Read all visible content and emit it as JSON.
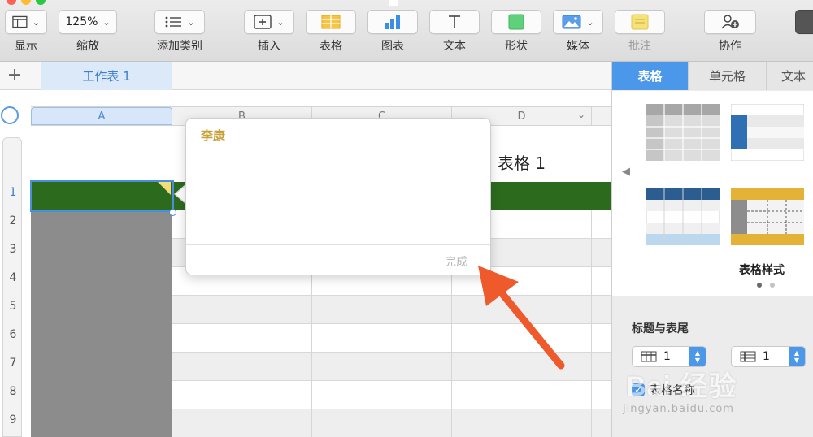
{
  "toolbar": {
    "view_label": "显示",
    "zoom_value": "125%",
    "zoom_label": "缩放",
    "add_category_label": "添加类别",
    "insert_label": "插入",
    "table_label": "表格",
    "chart_label": "图表",
    "text_label": "文本",
    "shape_label": "形状",
    "media_label": "媒体",
    "comment_label": "批注",
    "collaborate_label": "协作"
  },
  "sheets": {
    "active_tab": "工作表 1"
  },
  "table": {
    "title": "表格 1",
    "columns": [
      "A",
      "B",
      "C",
      "D"
    ],
    "rows": [
      "1",
      "2",
      "3",
      "4",
      "5",
      "6",
      "7",
      "8",
      "9"
    ],
    "header_color": "#2c6b1e",
    "selected_cell": "A1"
  },
  "comment": {
    "author": "李康",
    "done_label": "完成",
    "author_color": "#c7a13a"
  },
  "inspector": {
    "tabs": [
      "表格",
      "单元格",
      "文本"
    ],
    "active_tab": "表格",
    "styles_label": "表格样式",
    "header_footer_label": "标题与表尾",
    "header_rows": "1",
    "header_cols": "1",
    "table_name_checkbox": "表格名称",
    "accent_color": "#4b97ea"
  },
  "watermark": {
    "brand": "Bai 经验",
    "url": "jingyan.baidu.com"
  }
}
